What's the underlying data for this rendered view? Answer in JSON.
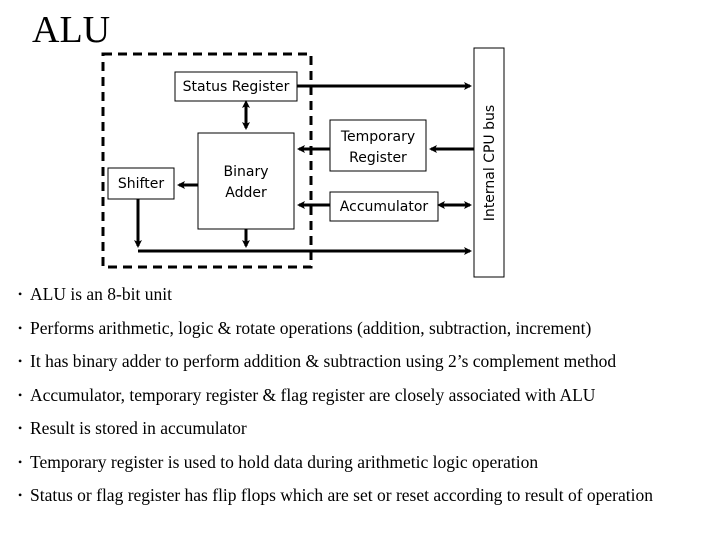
{
  "slide": {
    "title": "ALU"
  },
  "diagram": {
    "blocks": {
      "status_register": "Status Register",
      "binary_adder_line1": "Binary",
      "binary_adder_line2": "Adder",
      "shifter": "Shifter",
      "temporary_register_line1": "Temporary",
      "temporary_register_line2": "Register",
      "accumulator": "Accumulator",
      "internal_cpu_bus": "Internal CPU bus"
    },
    "connections": [
      {
        "from": "Status Register",
        "to": "Binary Adder",
        "type": "bidirectional"
      },
      {
        "from": "Status Register",
        "to": "Internal CPU bus",
        "type": "unidirectional"
      },
      {
        "from": "Temporary Register",
        "to": "Binary Adder",
        "type": "unidirectional"
      },
      {
        "from": "Internal CPU bus",
        "to": "Temporary Register",
        "type": "unidirectional"
      },
      {
        "from": "Accumulator",
        "to": "Binary Adder",
        "type": "unidirectional"
      },
      {
        "from": "Accumulator",
        "to": "Internal CPU bus",
        "type": "bidirectional"
      },
      {
        "from": "Binary Adder",
        "to": "Shifter",
        "type": "unidirectional"
      },
      {
        "from": "Shifter",
        "to": "Internal CPU bus",
        "type": "unidirectional"
      },
      {
        "from": "Binary Adder",
        "to": "Internal CPU bus",
        "type": "unidirectional"
      }
    ]
  },
  "bullets": [
    "ALU is an 8-bit unit",
    "Performs arithmetic, logic & rotate operations (addition, subtraction, increment)",
    "It has binary adder to perform addition & subtraction using 2’s complement method",
    "Accumulator, temporary register & flag register are closely associated with ALU",
    "Result is stored in accumulator",
    "Temporary register is used to hold data during arithmetic logic operation",
    "Status or flag register has flip flops which are set or reset according to result of operation"
  ],
  "bullet_marker": "•"
}
